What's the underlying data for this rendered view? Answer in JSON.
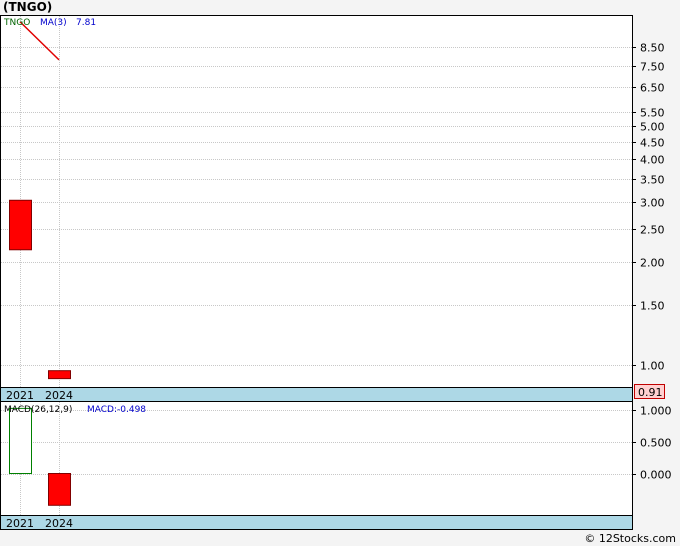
{
  "title": "(TNGO)",
  "footer": "© 12Stocks.com",
  "colors": {
    "up_candle": "#ff0000",
    "macd_box": "#008000",
    "axis_band": "#add8e6",
    "grid": "#c8c8c8",
    "ma_line": "#e00000",
    "label_blue": "#0000cc",
    "label_green": "#006400"
  },
  "chart_data": [
    {
      "type": "candlestick",
      "name": "price",
      "legend": {
        "symbol": "TNGO",
        "ma_label": "MA(3)",
        "ma_value": "7.81"
      },
      "y_scale": "log",
      "ylim": [
        0.86,
        10.5
      ],
      "y_ticks": [
        {
          "v": 8.5,
          "label": "8.50"
        },
        {
          "v": 7.5,
          "label": "7.50"
        },
        {
          "v": 6.5,
          "label": "6.50"
        },
        {
          "v": 5.5,
          "label": "5.50"
        },
        {
          "v": 5.0,
          "label": "5.00"
        },
        {
          "v": 4.5,
          "label": "4.50"
        },
        {
          "v": 4.0,
          "label": "4.00"
        },
        {
          "v": 3.5,
          "label": "3.50"
        },
        {
          "v": 3.0,
          "label": "3.00"
        },
        {
          "v": 2.5,
          "label": "2.50"
        },
        {
          "v": 2.0,
          "label": "2.00"
        },
        {
          "v": 1.5,
          "label": "1.50"
        },
        {
          "v": 1.0,
          "label": "1.00"
        }
      ],
      "x_labels": [
        "2021",
        "2024"
      ],
      "candles": [
        {
          "label": "2021",
          "open": 2.17,
          "close": 3.03,
          "color": "#ff0000"
        },
        {
          "label": "2024",
          "open": 0.91,
          "close": 0.96,
          "color": "#ff0000"
        }
      ],
      "ma_line": [
        {
          "label": "2021",
          "value": 10.1
        },
        {
          "label": "2024",
          "value": 7.81
        }
      ],
      "last_price_label": "0.91"
    },
    {
      "type": "bar",
      "name": "macd",
      "legend": {
        "label": "MACD(26,12,9)",
        "value_label": "MACD:-0.498"
      },
      "ylim": [
        -0.65,
        1.12
      ],
      "y_ticks": [
        {
          "v": 1.0,
          "label": "1.000"
        },
        {
          "v": 0.5,
          "label": "0.500"
        },
        {
          "v": 0.0,
          "label": "0.000"
        }
      ],
      "x_labels": [
        "2021",
        "2024"
      ],
      "bars": [
        {
          "label": "2021",
          "value": 1.02,
          "filled": false,
          "color": "#008000"
        },
        {
          "label": "2024",
          "value": -0.498,
          "filled": true,
          "color": "#ff0000"
        }
      ]
    }
  ]
}
